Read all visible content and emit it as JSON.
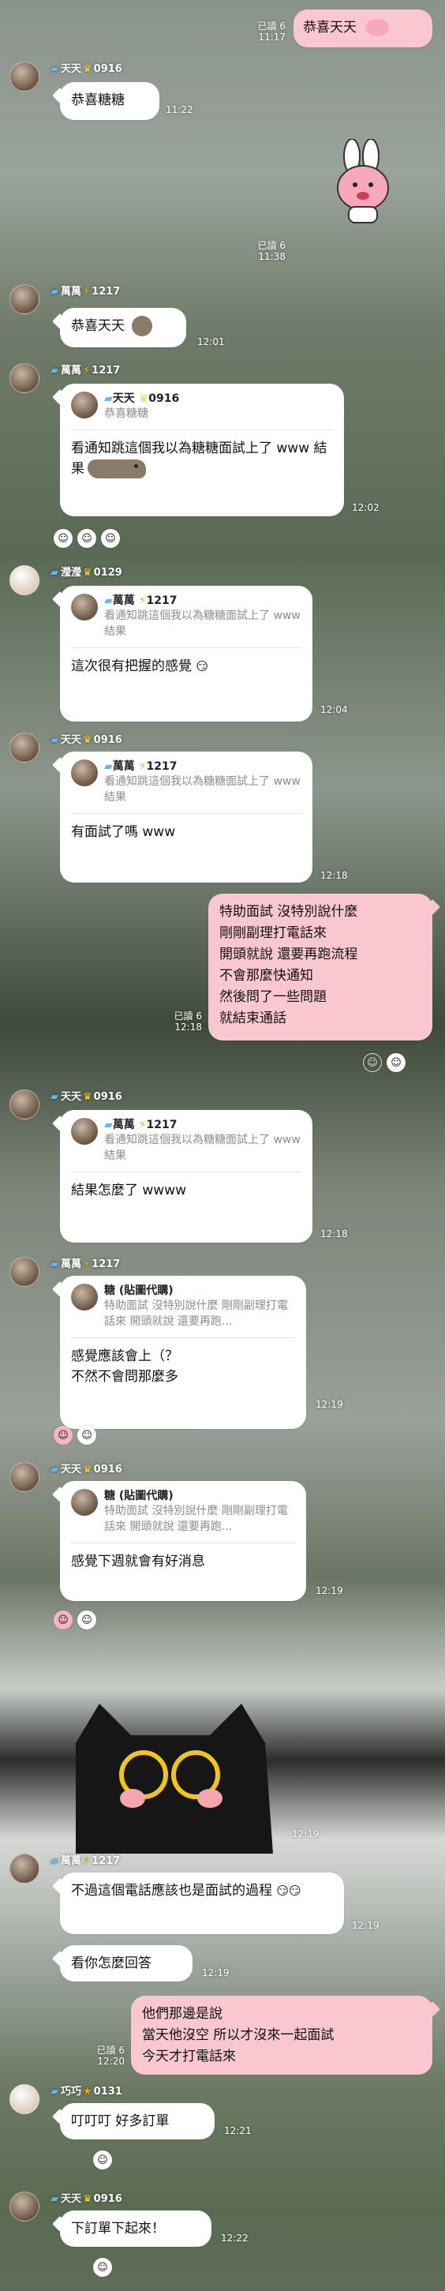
{
  "messages": {
    "m1": {
      "text": "恭喜天天",
      "read": "已讀 6",
      "time": "11:17"
    },
    "m2": {
      "sender": "天天",
      "level": "0916",
      "text": "恭喜糖糖",
      "time": "11:22"
    },
    "m3": {
      "read": "已讀 6",
      "time": "11:38"
    },
    "m4": {
      "sender": "萬萬",
      "level": "1217",
      "text": "恭喜天天",
      "time": "12:01"
    },
    "m5": {
      "sender": "萬萬",
      "level": "1217",
      "quote_name": "天天",
      "quote_level": "0916",
      "quote_text": "恭喜糖糖",
      "text": "看通知跳這個我以為糖糖面試上了 www 結果",
      "time": "12:02"
    },
    "m6": {
      "sender": "瀅瀅",
      "level": "0129",
      "quote_name": "萬萬",
      "quote_level": "1217",
      "quote_text": "看通知跳這個我以為糖糖面試上了 www 結果",
      "text": "這次很有把握的感覺",
      "time": "12:04"
    },
    "m7": {
      "sender": "天天",
      "level": "0916",
      "quote_name": "萬萬",
      "quote_level": "1217",
      "quote_text": "看通知跳這個我以為糖糖面試上了 www 結果",
      "text": "有面試了嗎 www",
      "time": "12:18"
    },
    "m8": {
      "lines": [
        "特助面試 沒特別說什麼",
        "剛剛副理打電話來",
        "開頭就說 還要再跑流程",
        "不會那麼快通知",
        "然後問了一些問題",
        "就結束通話"
      ],
      "read": "已讀 6",
      "time": "12:18"
    },
    "m9": {
      "sender": "天天",
      "level": "0916",
      "quote_name": "萬萬",
      "quote_level": "1217",
      "quote_text": "看通知跳這個我以為糖糖面試上了 www 結果",
      "text": "結果怎麼了 wwww",
      "time": "12:18"
    },
    "m10": {
      "sender": "萬萬",
      "level": "1217",
      "quote_name": "糖",
      "quote_tag": "(貼圖代購)",
      "quote_text": "特助面試 沒特別說什麼 剛剛副理打電話來 開頭就說 還要再跑...",
      "text": "感覺應該會上（？\n不然不會問那麼多",
      "time": "12:19"
    },
    "m11": {
      "sender": "天天",
      "level": "0916",
      "quote_name": "糖",
      "quote_tag": "(貼圖代購)",
      "quote_text": "特助面試 沒特別說什麼 剛剛副理打電話來 開頭就說 還要再跑...",
      "text": "感覺下週就會有好消息",
      "time": "12:19"
    },
    "m12": {
      "time": "12:19"
    },
    "m13": {
      "sender": "萬萬",
      "level": "1217",
      "text": "不過這個電話應該也是面試的過程",
      "time": "12:19"
    },
    "m14": {
      "text": "看你怎麼回答",
      "time": "12:19"
    },
    "m15": {
      "lines": [
        "他們那邊是說",
        "當天他沒空 所以才沒來一起面試",
        "今天才打電話來"
      ],
      "read": "已讀 6",
      "time": "12:20"
    },
    "m16": {
      "sender": "巧巧",
      "level": "0131",
      "text": "叮叮叮 好多訂單",
      "time": "12:21"
    },
    "m17": {
      "sender": "天天",
      "level": "0916",
      "text": "下訂單下起來！",
      "time": "12:22"
    }
  },
  "icons": [
    "flag-icon",
    "crown-icon",
    "bolt-icon",
    "star-icon",
    "smile-reaction-icon",
    "add-reaction-icon",
    "sticker-icon"
  ],
  "colors": {
    "mine_bubble": "#f9c7cf",
    "other_bubble": "#ffffff"
  }
}
